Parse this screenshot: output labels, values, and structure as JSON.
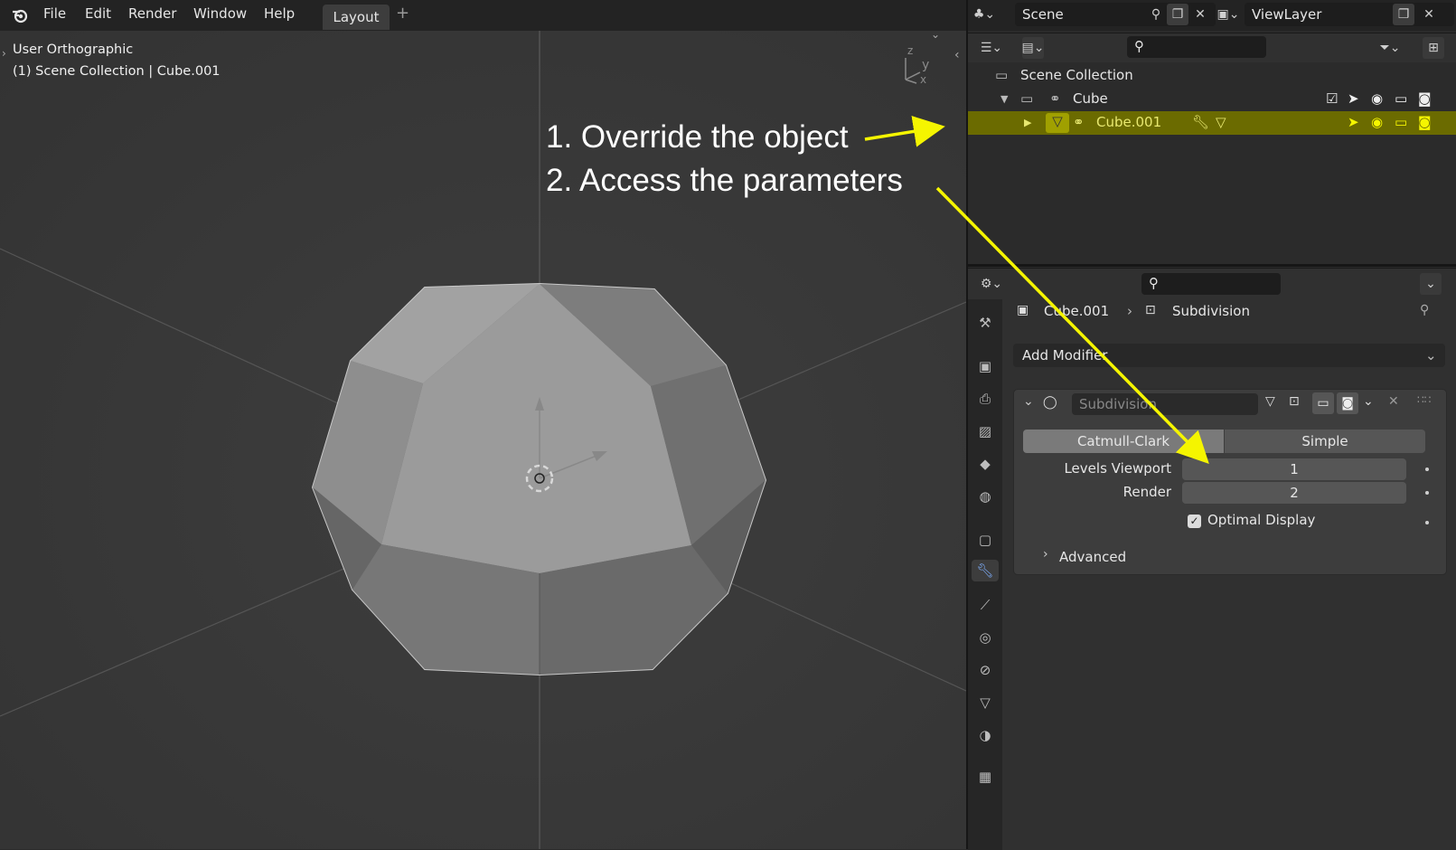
{
  "menu": {
    "items": [
      "File",
      "Edit",
      "Render",
      "Window",
      "Help"
    ],
    "active_tab": "Layout",
    "add_tab": "+"
  },
  "header_right": {
    "scene": "Scene",
    "view_layer": "ViewLayer"
  },
  "viewport": {
    "view_name": "User Orthographic",
    "collection_info": "(1) Scene Collection | Cube.001",
    "axis_labels": [
      "z",
      "y",
      "x"
    ]
  },
  "annotations": {
    "step1": "1. Override the object",
    "step2": "2. Access the parameters",
    "arrow_color": "#f5f500"
  },
  "outliner": {
    "root": "Scene Collection",
    "rows": [
      {
        "name": "Cube",
        "selected": false
      },
      {
        "name": "Cube.001",
        "selected": true
      }
    ]
  },
  "properties": {
    "breadcrumb_object": "Cube.001",
    "breadcrumb_modifier": "Subdivision",
    "add_modifier": "Add Modifier",
    "modifier": {
      "name": "Subdivision",
      "mode_options": [
        "Catmull-Clark",
        "Simple"
      ],
      "mode_selected": "Catmull-Clark",
      "levels_viewport_label": "Levels Viewport",
      "levels_viewport": "1",
      "render_label": "Render",
      "render": "2",
      "optimal_display_label": "Optimal Display",
      "optimal_display": true,
      "advanced_label": "Advanced"
    }
  },
  "colors": {
    "highlight": "#6b6b00",
    "accent_text": "#e8e870"
  }
}
